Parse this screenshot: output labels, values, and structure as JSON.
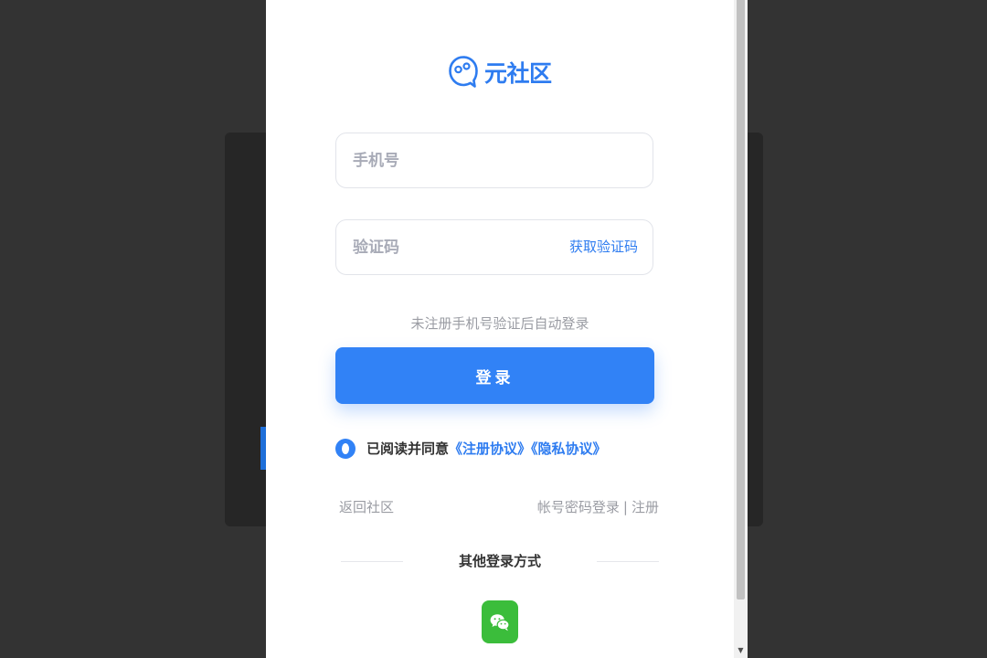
{
  "brand": {
    "name": "元社区",
    "accent_color": "#2e7cf0",
    "logo_icon": "bubble-face-icon"
  },
  "form": {
    "phone": {
      "placeholder": "手机号",
      "value": ""
    },
    "code": {
      "placeholder": "验证码",
      "value": "",
      "get_code_label": "获取验证码"
    },
    "hint": "未注册手机号验证后自动登录",
    "login_label": "登录",
    "login_color": "#3182f6"
  },
  "agreement": {
    "prefix": "已阅读并同意",
    "terms_label": "《注册协议》",
    "privacy_label": "《隐私协议》",
    "checked": true
  },
  "links": {
    "back": "返回社区",
    "password_login": "帐号密码登录",
    "separator": "|",
    "register": "注册"
  },
  "other": {
    "title": "其他登录方式",
    "wechat_icon": "wechat-icon",
    "wechat_color": "#3bbd3b"
  }
}
